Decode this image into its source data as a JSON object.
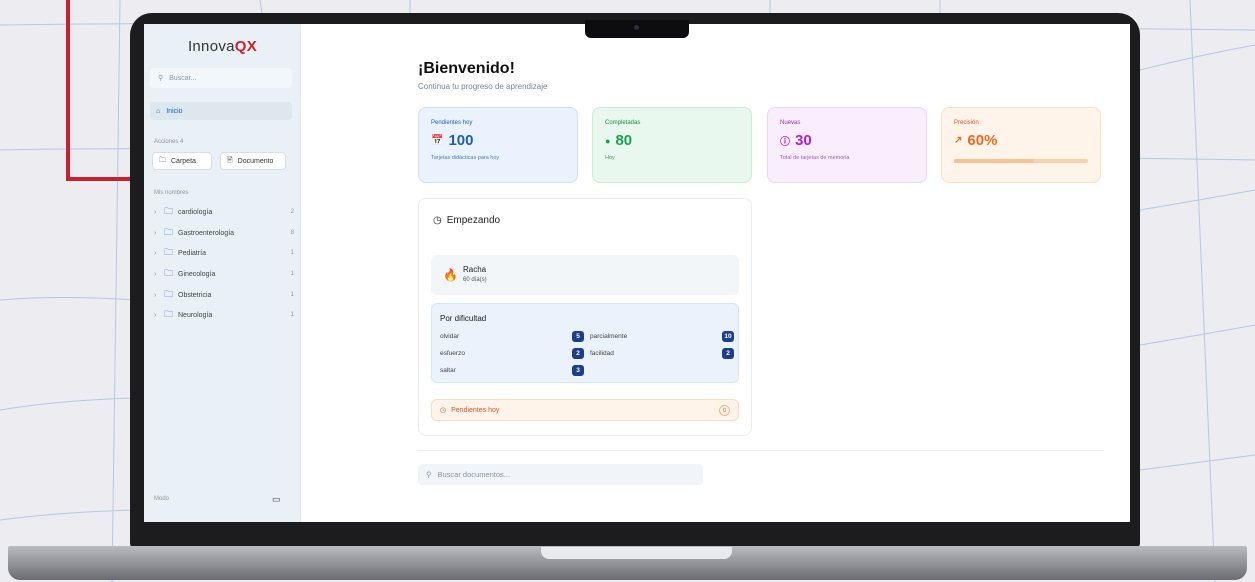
{
  "colors": {
    "brand_red": "#c8202c",
    "primary_blue": "#1f5fb0",
    "success_green": "#1aa251",
    "new_purple": "#b21fd1",
    "progress_orange": "#ef6a20"
  },
  "sidebar": {
    "logo_text": "Innova",
    "logo_accent": "QX",
    "search_placeholder": "Buscar...",
    "home_label": "Inicio",
    "actions_label": "Acciones",
    "actions_count": "4",
    "folder_button": "Carpeta",
    "document_button": "Documento",
    "my_names_label": "Mis nombres",
    "folders": [
      {
        "label": "cardiología",
        "count": "2"
      },
      {
        "label": "Gastroenterología",
        "count": "8"
      },
      {
        "label": "Pediatría",
        "count": "1"
      },
      {
        "label": "Ginecología",
        "count": "1"
      },
      {
        "label": "Obstetricia",
        "count": "1"
      },
      {
        "label": "Neurología",
        "count": "1"
      }
    ],
    "mode_label": "Modo"
  },
  "main": {
    "title": "¡Bienvenido!",
    "subtitle": "Continua tu progreso de aprendizaje",
    "cards": [
      {
        "title": "Pendientes hoy",
        "value": "100",
        "sub": "Tarjetas didácticas para hoy"
      },
      {
        "title": "Completadas",
        "value": "80",
        "sub": "Hoy"
      },
      {
        "title": "Nuevas",
        "value": "30",
        "sub": "Total de tarjetas de memoria"
      },
      {
        "title": "Precisión",
        "value": "60%",
        "progress": 0.6
      }
    ],
    "panel": {
      "title": "Empezando",
      "streak_title": "Racha",
      "streak_value": "60 día(s)",
      "difficulty_title": "Por dificultad",
      "difficulty": [
        {
          "label": "olvidar",
          "count": "5"
        },
        {
          "label": "parcialmente",
          "count": "10"
        },
        {
          "label": "esfuerzo",
          "count": "2"
        },
        {
          "label": "facilidad",
          "count": "2"
        },
        {
          "label": "saltar",
          "count": "3"
        }
      ],
      "pending_label": "Pendientes hoy",
      "pending_count": "0"
    },
    "doc_search_placeholder": "Buscar documentos..."
  }
}
